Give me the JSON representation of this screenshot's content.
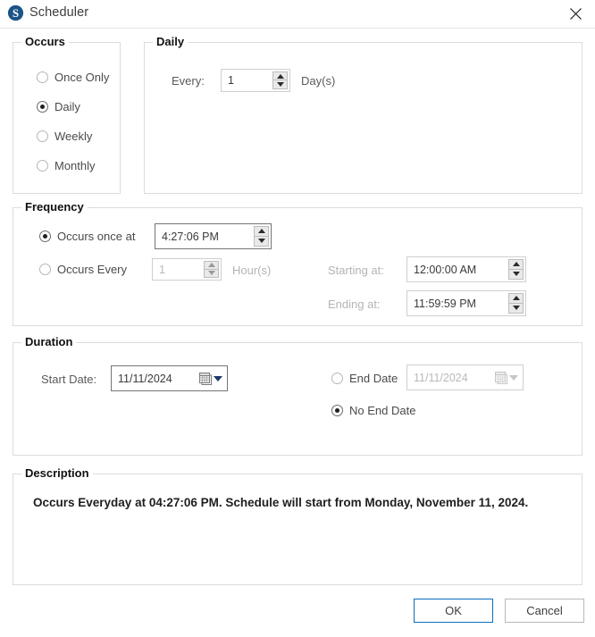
{
  "window": {
    "title": "Scheduler",
    "app_icon": "syncfusion-s-icon",
    "close_icon": "close-icon"
  },
  "occurs": {
    "title": "Occurs",
    "options": [
      {
        "label": "Once Only",
        "selected": false
      },
      {
        "label": "Daily",
        "selected": true
      },
      {
        "label": "Weekly",
        "selected": false
      },
      {
        "label": "Monthly",
        "selected": false
      }
    ]
  },
  "daily": {
    "title": "Daily",
    "every_label": "Every:",
    "every_value": "1",
    "unit_label": "Day(s)"
  },
  "frequency": {
    "title": "Frequency",
    "once_at_label": "Occurs once at",
    "once_at_selected": true,
    "once_at_time": "4:27:06 PM",
    "every_label": "Occurs Every",
    "every_selected": false,
    "every_value": "1",
    "every_unit": "Hour(s)",
    "starting_label": "Starting at:",
    "starting_value": "12:00:00 AM",
    "ending_label": "Ending at:",
    "ending_value": "11:59:59 PM"
  },
  "duration": {
    "title": "Duration",
    "start_date_label": "Start Date:",
    "start_date_value": "11/11/2024",
    "end_date_label": "End Date",
    "end_date_selected": false,
    "end_date_value": "11/11/2024",
    "no_end_date_label": "No End Date",
    "no_end_date_selected": true
  },
  "description": {
    "title": "Description",
    "text": "Occurs Everyday at 04:27:06 PM. Schedule will start from Monday, November 11, 2024."
  },
  "buttons": {
    "ok": "OK",
    "cancel": "Cancel"
  },
  "colors": {
    "accent": "#0a6fc2",
    "logo": "#1b5486",
    "group_border": "#dcdcdc"
  }
}
